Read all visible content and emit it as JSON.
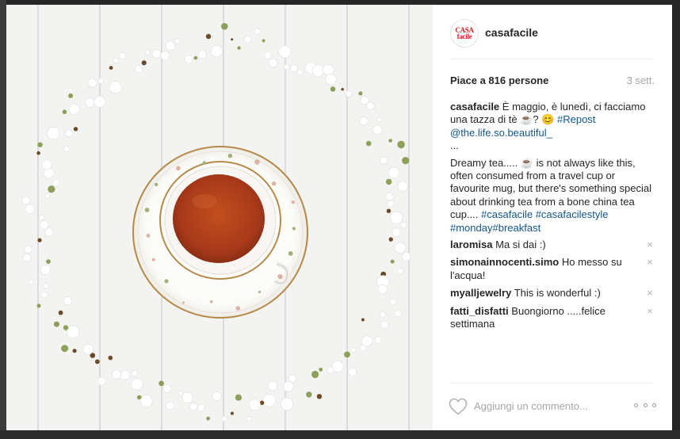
{
  "post": {
    "account": {
      "username": "casafacile",
      "avatar_line1": "CASA",
      "avatar_line2": "facile"
    },
    "likes_text": "Piace a 816 persone",
    "time_ago": "3 sett.",
    "caption": {
      "user": "casafacile",
      "text_it": " È maggio, è lunedì, ci facciamo una tazza di tè ☕? 😊 ",
      "repost_tag": "#Repost",
      "mention": "@the.life.so.beautiful_",
      "ellipsis": "...",
      "text_en": "Dreamy tea..... ☕ is not always like this, often consumed from a travel cup or favourite mug, but there's something special about drinking tea from a bone china tea cup.... ",
      "tags": [
        "#casafacile",
        "#casafacilestyle",
        "#monday",
        "#breakfast"
      ]
    },
    "comments": [
      {
        "user": "laromisa",
        "text": "Ma si dai :)"
      },
      {
        "user": "simonainnocenti.simo",
        "text": "Ho messo su l'acqua!"
      },
      {
        "user": "myalljewelry",
        "text": "This is wonderful :)"
      },
      {
        "user": "fatti_disfatti",
        "text": "Buongiorno .....felice settimana"
      }
    ],
    "remove_glyph": "×",
    "comment_placeholder": "Aggiungi un commento..."
  },
  "icons": {
    "like": "heart-icon",
    "options": "more-options-icon",
    "remove": "close-icon"
  },
  "colors": {
    "hashtag": "#125688",
    "tea": "#b4421a",
    "brand_red": "#d2232a",
    "muted": "#a5a7aa"
  }
}
